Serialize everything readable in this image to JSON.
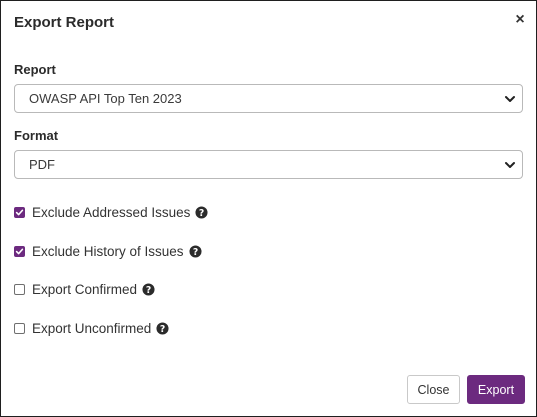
{
  "dialog": {
    "title": "Export Report",
    "close_icon": "close-icon"
  },
  "report": {
    "label": "Report",
    "selected": "OWASP API Top Ten 2023"
  },
  "format": {
    "label": "Format",
    "selected": "PDF"
  },
  "options": [
    {
      "label": "Exclude Addressed Issues",
      "checked": true
    },
    {
      "label": "Exclude History of Issues",
      "checked": true
    },
    {
      "label": "Export Confirmed",
      "checked": false
    },
    {
      "label": "Export Unconfirmed",
      "checked": false
    }
  ],
  "buttons": {
    "close_label": "Close",
    "export_label": "Export"
  },
  "colors": {
    "accent": "#6c2a7f",
    "border": "#b9b9b9"
  },
  "icons": {
    "help": "question-circle-icon",
    "chevron": "chevron-down-icon",
    "check": "check-icon"
  }
}
